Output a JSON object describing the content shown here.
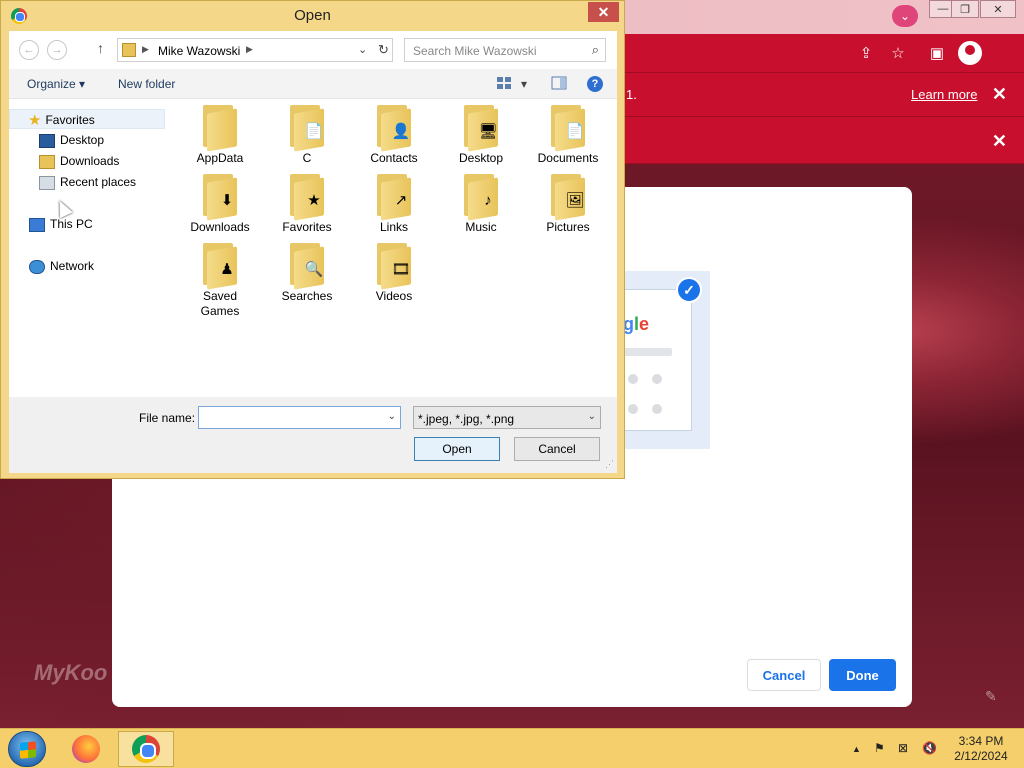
{
  "browser": {
    "infobar_text_1": "1.",
    "learn_more": "Learn more",
    "close_glyph": "✕",
    "min_glyph": "—",
    "restore_glyph": "❐",
    "share_glyph": "⇪",
    "bookmark_glyph": "☆",
    "sidepanel_glyph": "▣",
    "profile_glyph": "⌄"
  },
  "background_logo": "MyKoo",
  "google_dialog": {
    "logo_parts": [
      "o",
      "g",
      "l",
      "e"
    ],
    "cancel_label": "Cancel",
    "done_label": "Done",
    "check_glyph": "✓",
    "pencil_glyph": "✎"
  },
  "open_dialog": {
    "title": "Open",
    "close_glyph": "✕",
    "nav": {
      "back_glyph": "←",
      "forward_glyph": "→",
      "up_glyph": "↑",
      "address_crumb": "Mike Wazowski",
      "crumb_sep": "▶",
      "dropdown_glyph": "⌄",
      "refresh_glyph": "↻",
      "search_placeholder": "Search Mike Wazowski",
      "search_glyph": "⌕"
    },
    "commands": {
      "organize": "Organize ▾",
      "new_folder": "New folder",
      "view_drop": "▾",
      "help": "?"
    },
    "nav_pane": {
      "favorites": "Favorites",
      "desktop": "Desktop",
      "downloads": "Downloads",
      "recent": "Recent places",
      "this_pc": "This PC",
      "network": "Network",
      "star_glyph": "★"
    },
    "files": [
      {
        "label": "AppData",
        "badge": ""
      },
      {
        "label": "C",
        "badge": "📄"
      },
      {
        "label": "Contacts",
        "badge": "👤"
      },
      {
        "label": "Desktop",
        "badge": "🖥"
      },
      {
        "label": "Documents",
        "badge": "📄"
      },
      {
        "label": "Downloads",
        "badge": "⬇"
      },
      {
        "label": "Favorites",
        "badge": "★"
      },
      {
        "label": "Links",
        "badge": "↗"
      },
      {
        "label": "Music",
        "badge": "♪"
      },
      {
        "label": "Pictures",
        "badge": "🖼"
      },
      {
        "label": "Saved Games",
        "badge": "♟"
      },
      {
        "label": "Searches",
        "badge": "🔍"
      },
      {
        "label": "Videos",
        "badge": "🎞"
      }
    ],
    "file_name_label": "File name:",
    "file_name_value": "",
    "file_type": "*.jpeg, *.jpg, *.png",
    "open_label": "Open",
    "cancel_label": "Cancel",
    "drop_glyph": "⌄"
  },
  "taskbar": {
    "time": "3:34 PM",
    "date": "2/12/2024",
    "tray_up": "▲",
    "tray_flag": "⚑",
    "tray_net": "⊠",
    "tray_vol": "🔇"
  }
}
